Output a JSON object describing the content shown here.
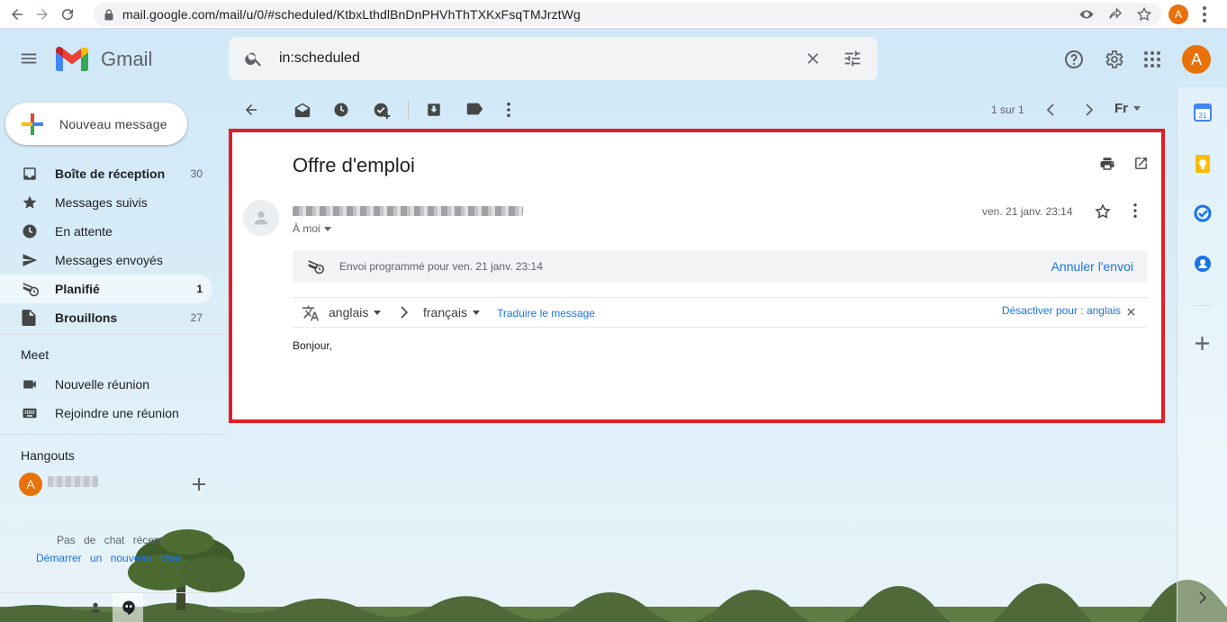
{
  "browser": {
    "url": "mail.google.com/mail/u/0/#scheduled/KtbxLthdlBnDnPHVhThTXKxFsqTMJrztWg",
    "avatar_letter": "A"
  },
  "header": {
    "app_name": "Gmail",
    "search_value": "in:scheduled",
    "avatar_letter": "A"
  },
  "sidebar": {
    "compose_label": "Nouveau message",
    "items": [
      {
        "label": "Boîte de réception",
        "count": "30"
      },
      {
        "label": "Messages suivis",
        "count": ""
      },
      {
        "label": "En attente",
        "count": ""
      },
      {
        "label": "Messages envoyés",
        "count": ""
      },
      {
        "label": "Planifié",
        "count": "1"
      },
      {
        "label": "Brouillons",
        "count": "27"
      }
    ],
    "meet_title": "Meet",
    "meet_items": [
      "Nouvelle réunion",
      "Rejoindre une réunion"
    ],
    "hangouts_title": "Hangouts",
    "hangouts_avatar_letter": "A",
    "no_chat_text": "Pas de chat récent",
    "start_chat_text": "Démarrer un nouveau chat"
  },
  "toolbar": {
    "pager_text": "1 sur 1",
    "lang_label": "Fr"
  },
  "message": {
    "subject": "Offre d'emploi",
    "to_label": "À moi",
    "date": "ven. 21 janv. 23:14",
    "scheduled_text": "Envoi programmé pour ven. 21 janv. 23:14",
    "cancel_send_label": "Annuler l'envoi",
    "translate": {
      "from": "anglais",
      "to": "français",
      "translate_link": "Traduire le message",
      "disable_label": "Désactiver pour : anglais"
    },
    "body": "Bonjour,"
  },
  "colors": {
    "accent_blue": "#1a73e8",
    "highlight_border": "#e01e26",
    "avatar_orange": "#e8710a"
  }
}
